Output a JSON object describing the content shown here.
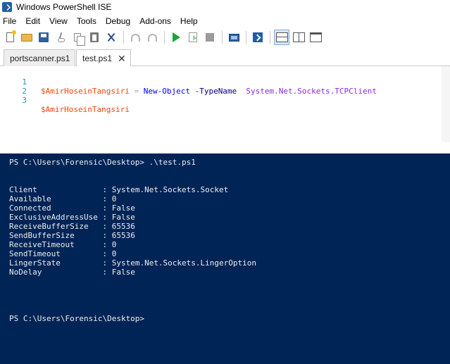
{
  "window": {
    "title": "Windows PowerShell ISE"
  },
  "menu": [
    "File",
    "Edit",
    "View",
    "Tools",
    "Debug",
    "Add-ons",
    "Help"
  ],
  "toolbar_icons": [
    "new-script-icon",
    "open-icon",
    "save-icon",
    "cut-icon",
    "copy-icon",
    "paste-icon",
    "clear-console-icon",
    "undo-icon",
    "redo-icon",
    "run-script-icon",
    "run-selection-icon",
    "stop-icon",
    "remote-powershell-tab-icon",
    "powershell-console-icon",
    "script-pane-top-icon",
    "script-pane-right-icon",
    "script-pane-maximized-icon"
  ],
  "tabs": [
    {
      "label": "portscanner.ps1",
      "active": false
    },
    {
      "label": "test.ps1",
      "active": true,
      "close": "✕"
    }
  ],
  "editor": {
    "lines": [
      {
        "num": "1",
        "var": "$AmirHoseinTangsiri",
        "op": " = ",
        "cmd": "New-Object",
        "param": " -TypeName",
        "arg": "  System.Net.Sockets.TCPClient"
      },
      {
        "num": "2"
      },
      {
        "num": "3",
        "var": "$AmirHoseinTangsiri"
      }
    ]
  },
  "console": {
    "prompt1": "PS C:\\Users\\Forensic\\Desktop> .\\test.ps1",
    "output": [
      {
        "name": "Client             ",
        "value": ": System.Net.Sockets.Socket"
      },
      {
        "name": "Available          ",
        "value": ": 0"
      },
      {
        "name": "Connected          ",
        "value": ": False"
      },
      {
        "name": "ExclusiveAddressUse",
        "value": ": False"
      },
      {
        "name": "ReceiveBufferSize  ",
        "value": ": 65536"
      },
      {
        "name": "SendBufferSize     ",
        "value": ": 65536"
      },
      {
        "name": "ReceiveTimeout     ",
        "value": ": 0"
      },
      {
        "name": "SendTimeout        ",
        "value": ": 0"
      },
      {
        "name": "LingerState        ",
        "value": ": System.Net.Sockets.LingerOption"
      },
      {
        "name": "NoDelay            ",
        "value": ": False"
      }
    ],
    "prompt2": "PS C:\\Users\\Forensic\\Desktop>"
  }
}
